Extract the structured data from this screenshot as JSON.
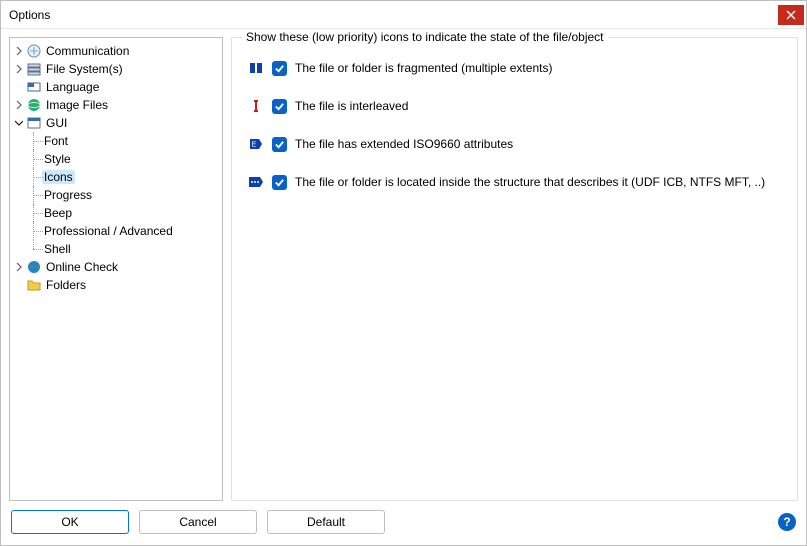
{
  "window": {
    "title": "Options"
  },
  "tree": {
    "communication": "Communication",
    "file_systems": "File System(s)",
    "language": "Language",
    "image_files": "Image Files",
    "gui": "GUI",
    "gui_children": {
      "font": "Font",
      "style": "Style",
      "icons": "Icons",
      "progress": "Progress",
      "beep": "Beep",
      "prof_adv": "Professional / Advanced",
      "shell": "Shell"
    },
    "online_check": "Online Check",
    "folders": "Folders"
  },
  "group": {
    "title": "Show these (low priority) icons to indicate the state of the file/object",
    "items": {
      "fragmented": {
        "label": "The file or folder is fragmented (multiple extents)",
        "checked": true
      },
      "interleaved": {
        "label": "The file is interleaved",
        "checked": true
      },
      "iso9660": {
        "label": "The file has extended ISO9660 attributes",
        "checked": true
      },
      "inside_struct": {
        "label": "The file or folder is located inside the structure that describes it (UDF ICB, NTFS MFT, ..)",
        "checked": true
      }
    }
  },
  "buttons": {
    "ok": "OK",
    "cancel": "Cancel",
    "default": "Default"
  }
}
